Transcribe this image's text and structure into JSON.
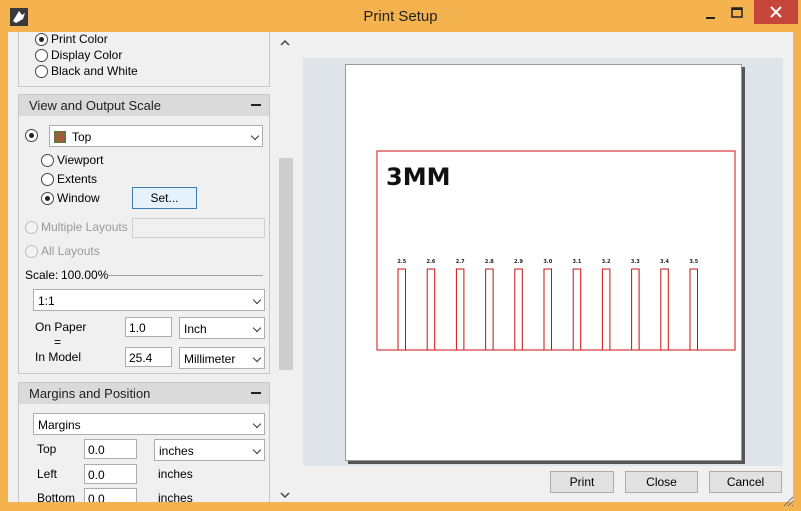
{
  "window": {
    "title": "Print Setup"
  },
  "icons": {
    "app": "print-icon",
    "minimize": "minimize-icon",
    "maximize": "maximize-icon",
    "close": "close-icon",
    "viewport": "viewport-grid-icon",
    "scroll_up": "chevron-up-icon",
    "scroll_down": "chevron-down-icon",
    "resize": "resize-grip-icon"
  },
  "colors": {
    "titlebar": "#f5b34f",
    "close_button": "#c7463b",
    "preview_bg": "#dfe3ea",
    "drawing": "#cc1111"
  },
  "output_color": {
    "options": [
      {
        "label": "Print Color",
        "selected": true
      },
      {
        "label": "Display Color",
        "selected": false
      },
      {
        "label": "Black and White",
        "selected": false
      }
    ]
  },
  "view_scale": {
    "title": "View and Output Scale",
    "view": {
      "value": "Top"
    },
    "area": [
      {
        "label": "Viewport",
        "selected": false
      },
      {
        "label": "Extents",
        "selected": false
      },
      {
        "label": "Window",
        "selected": true
      }
    ],
    "set_button": "Set...",
    "multiple_layouts": "Multiple Layouts",
    "all_layouts": "All Layouts",
    "scale_label": "Scale:",
    "scale_value": "100.00%",
    "scale_ratio": "1:1",
    "on_paper_label": "On Paper",
    "equals": "=",
    "in_model_label": "In Model",
    "on_paper_value": "1.0",
    "on_paper_unit": "Inch",
    "in_model_value": "25.4",
    "in_model_unit": "Millimeter"
  },
  "margins": {
    "title": "Margins and Position",
    "mode": "Margins",
    "top_label": "Top",
    "top_value": "0.0",
    "top_unit": "inches",
    "left_label": "Left",
    "left_value": "0.0",
    "left_unit": "inches",
    "bottom_label": "Bottom",
    "bottom_value": "0.0",
    "bottom_unit": "inches"
  },
  "preview": {
    "heading": "3MM",
    "labels": [
      "2.5",
      "2.6",
      "2.7",
      "2.8",
      "2.9",
      "3.0",
      "3.1",
      "3.2",
      "3.3",
      "3.4",
      "3.5"
    ]
  },
  "buttons": {
    "print": "Print",
    "close": "Close",
    "cancel": "Cancel"
  }
}
